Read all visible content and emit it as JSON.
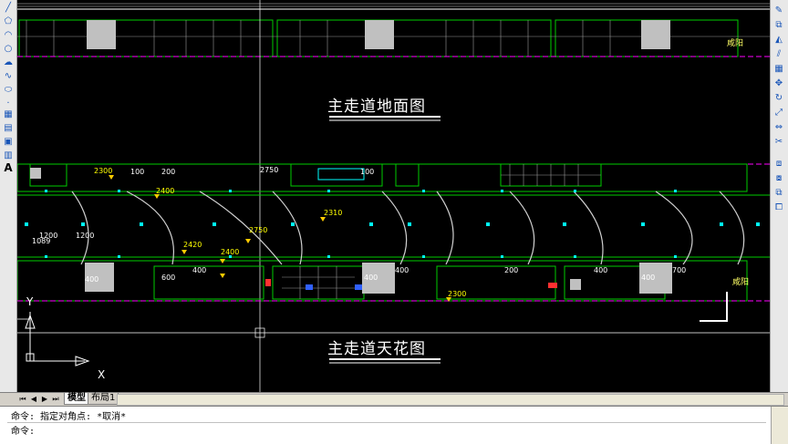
{
  "drawing": {
    "title_floor": "主走道地面图",
    "title_ceiling": "主走道天花图",
    "dims": [
      "2300",
      "2400",
      "2750",
      "2310",
      "2420",
      "2400",
      "2750",
      "2300",
      "1200",
      "1200",
      "400",
      "400",
      "600",
      "400",
      "400",
      "400",
      "400",
      "200",
      "200",
      "100",
      "100",
      "1089",
      "700"
    ],
    "tags": [
      "咸阳",
      "咸阳"
    ],
    "axis": {
      "x": "X",
      "y": "Y"
    }
  },
  "left_tools": [
    "line",
    "polyline",
    "arc",
    "circle",
    "revcloud",
    "spline",
    "ellipse",
    "insert",
    "point",
    "hatch",
    "gradient",
    "region",
    "table",
    "mtext"
  ],
  "left_text_tool": "A",
  "tabs": {
    "model": "模型",
    "layout1": "布局1"
  },
  "command": {
    "history": "命令: 指定对角点: *取消*",
    "prompt": "命令:"
  },
  "colors": {
    "canvas": "#000000",
    "frame": "#00ff00",
    "magenta_dash": "#ff00ff",
    "cyan_light": "#00ffff",
    "dim_text": "#ffff00"
  }
}
